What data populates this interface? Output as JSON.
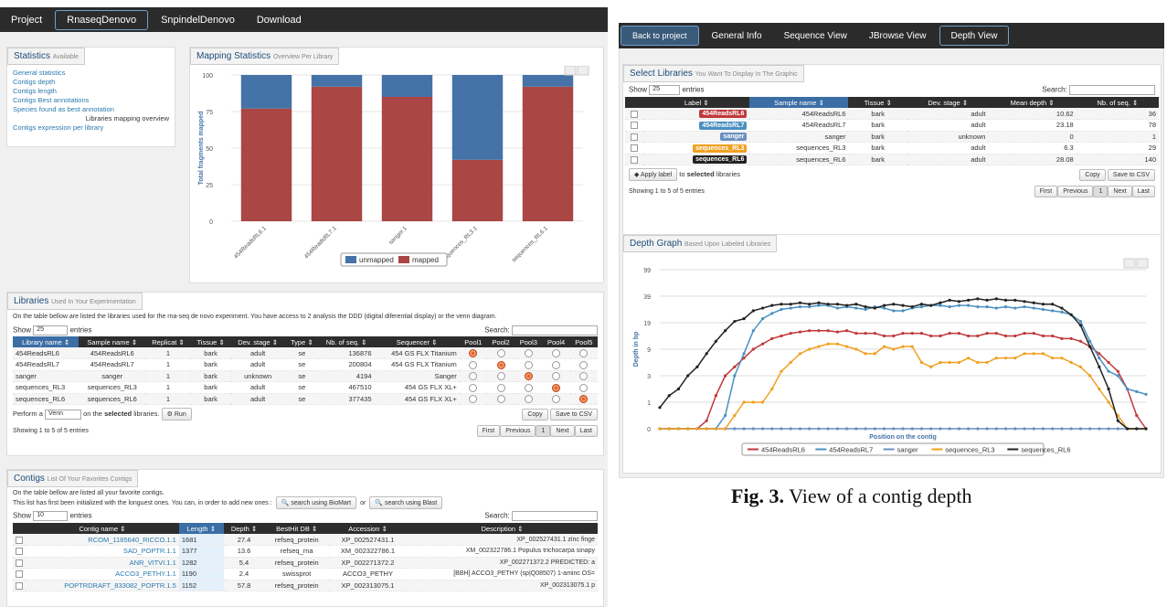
{
  "left": {
    "nav": [
      "Project",
      "RnaseqDenovo",
      "SnpindelDenovo",
      "Download"
    ],
    "stats": {
      "title": "Statistics",
      "sub": "Available",
      "links": [
        "General statistics",
        "Contigs depth",
        "Contigs length",
        "Contigs Best annotations",
        "Species found as best annotation"
      ],
      "current": "Libraries mapping overview",
      "last": "Contigs expression per library"
    },
    "mapping": {
      "title": "Mapping Statistics",
      "sub": "Overview Per Library"
    },
    "libs": {
      "title": "Libraries",
      "sub": "Used In Your Experimentation",
      "desc": "On the table bellow are listed the libraries used for the rna-seq de novo experiment. You have access to 2 analysis the DDD (digital diferential display) or the venn diagram.",
      "show": "Show",
      "n": "25",
      "entries": "entries",
      "search": "Search:",
      "headers": [
        "Library name",
        "Sample name",
        "Replicat",
        "Tissue",
        "Dev. stage",
        "Type",
        "Nb. of seq.",
        "Sequencer",
        "Pool1",
        "Pool2",
        "Pool3",
        "Pool4",
        "Pool5"
      ],
      "rows": [
        [
          "454ReadsRL6",
          "454ReadsRL6",
          "1",
          "bark",
          "adult",
          "se",
          "136876",
          "454 GS FLX Titanium"
        ],
        [
          "454ReadsRL7",
          "454ReadsRL7",
          "1",
          "bark",
          "adult",
          "se",
          "200804",
          "454 GS FLX Titanium"
        ],
        [
          "sanger",
          "sanger",
          "1",
          "bark",
          "unknown",
          "se",
          "4194",
          "Sanger"
        ],
        [
          "sequences_RL3",
          "sequences_RL3",
          "1",
          "bark",
          "adult",
          "se",
          "467510",
          "454 GS FLX XL+"
        ],
        [
          "sequences_RL6",
          "sequences_RL6",
          "1",
          "bark",
          "adult",
          "se",
          "377435",
          "454 GS FLX XL+"
        ]
      ],
      "pools": [
        0,
        1,
        2,
        3,
        4
      ],
      "perform": "Perform a",
      "venn": "Venn",
      "onsel": "on the",
      "selected": "selected",
      "libsuffix": "libraries.",
      "run": "Run",
      "copy": "Copy",
      "csv": "Save to CSV",
      "info": "Showing 1 to 5 of 5 entries",
      "first": "First",
      "prev": "Previous",
      "page": "1",
      "next": "Next",
      "last": "Last"
    },
    "contigs": {
      "title": "Contigs",
      "sub": "List Of Your Favorites Contigs",
      "desc1": "On the table bellow are listed all your favorite contigs.",
      "desc2": "This list has first been initialized with the longuest ones. You can, in order to add new ones :",
      "biomart": "search using BioMart",
      "or": "or",
      "blast": "search using Blast",
      "show": "Show",
      "n": "10",
      "entries": "entries",
      "search": "Search:",
      "headers": [
        "Contig name",
        "Length",
        "Depth",
        "BestHit DB",
        "Accession",
        "Description"
      ],
      "rows": [
        [
          "RCOM_1185640_RICCO.1.1",
          "1681",
          "27.4",
          "refseq_protein",
          "XP_002527431.1",
          "XP_002527431.1 zinc finge"
        ],
        [
          "SAD_POPTR.1.1",
          "1377",
          "13.6",
          "refseq_rna",
          "XM_002322786.1",
          "XM_002322786.1 Populus trichocarpa sinapy"
        ],
        [
          "ANR_VITVI.1.1",
          "1282",
          "5.4",
          "refseq_protein",
          "XP_002271372.2",
          "XP_002271372.2 PREDICTED: a"
        ],
        [
          "ACCO3_PETHY.1.1",
          "1190",
          "2.4",
          "swissprot",
          "ACCO3_PETHY",
          "[BBH] ACCO3_PETHY (sp|Q08507) 1-aminc OS="
        ],
        [
          "POPTRDRAFT_833082_POPTR.1.5",
          "1152",
          "57.8",
          "refseq_protein",
          "XP_002313075.1",
          "XP_002313075.1 p"
        ]
      ]
    }
  },
  "right": {
    "nav": [
      "Back to project",
      "General Info",
      "Sequence View",
      "JBrowse View",
      "Depth View"
    ],
    "select": {
      "title": "Select Libraries",
      "sub": "You Want To Display In The Graphic",
      "show": "Show",
      "n": "25",
      "entries": "entries",
      "search": "Search:",
      "headers": [
        "Label",
        "Sample name",
        "Tissue",
        "Dev. stage",
        "Mean depth",
        "Nb. of seq."
      ],
      "rows": [
        [
          "454ReadsRL6",
          "454ReadsRL6",
          "bark",
          "adult",
          "10.62",
          "36"
        ],
        [
          "454ReadsRL7",
          "454ReadsRL7",
          "bark",
          "adult",
          "23.18",
          "78"
        ],
        [
          "sanger",
          "sanger",
          "bark",
          "unknown",
          "0",
          "1"
        ],
        [
          "sequences_RL3",
          "sequences_RL3",
          "bark",
          "adult",
          "6.3",
          "29"
        ],
        [
          "sequences_RL6",
          "sequences_RL6",
          "bark",
          "adult",
          "28.08",
          "140"
        ]
      ],
      "apply": "Apply label",
      "to": "to",
      "selected": "selected",
      "libraries": "libraries",
      "copy": "Copy",
      "csv": "Save to CSV",
      "info": "Showing 1 to 5 of 5 entries",
      "first": "First",
      "prev": "Previous",
      "page": "1",
      "next": "Next",
      "last": "Last"
    },
    "depth": {
      "title": "Depth Graph",
      "sub": "Based Upon Labeled Libraries"
    },
    "caption_bold": "Fig. 3.",
    "caption_text": " View of a contig depth"
  },
  "colors": {
    "unmapped": "#4572a7",
    "mapped": "#aa4643",
    "rl6": "#c0393b",
    "rl7": "#4a90c0",
    "sanger": "#6a8fc0",
    "rl3": "#f0a020",
    "srl6": "#222222"
  },
  "chart_data": [
    {
      "type": "bar",
      "stacked": true,
      "categories": [
        "454ReadsRL6.1",
        "454ReadsRL7.1",
        "sanger.1",
        "sequences_RL3.1",
        "sequences_RL6.1"
      ],
      "series": [
        {
          "name": "unmapped",
          "values": [
            23,
            8,
            15,
            58,
            8
          ]
        },
        {
          "name": "mapped",
          "values": [
            77,
            92,
            85,
            42,
            92
          ]
        }
      ],
      "ylabel": "Total fragments mapped",
      "ylim": [
        0,
        100
      ],
      "yticks": [
        0,
        25,
        50,
        75,
        100
      ],
      "legend": "bottom"
    },
    {
      "type": "line",
      "xlabel": "Position on the contig",
      "ylabel": "Depth in bp",
      "yticks": [
        "0",
        "1",
        "3",
        "9",
        "19",
        "39",
        "99"
      ],
      "legend": "bottom",
      "series": [
        {
          "name": "454ReadsRL6",
          "values": [
            0,
            0,
            0,
            0,
            0,
            0.3,
            1.5,
            3,
            5,
            7,
            9,
            11,
            13,
            14,
            15,
            15.5,
            16,
            16,
            16,
            15.5,
            16,
            15,
            15,
            15,
            14,
            14,
            15,
            15,
            15,
            14,
            14,
            15,
            15,
            14,
            14,
            15,
            15,
            14,
            14,
            15,
            15,
            14,
            14,
            13,
            13,
            12,
            10,
            8,
            6,
            4,
            2,
            0.5,
            0
          ]
        },
        {
          "name": "454ReadsRL7",
          "values": [
            0,
            0,
            0,
            0,
            0,
            0,
            0,
            0.5,
            3,
            8,
            16,
            22,
            26,
            29,
            30,
            31,
            31,
            32,
            32,
            30,
            31,
            30,
            29,
            31,
            30,
            28,
            28,
            30,
            31,
            32,
            32,
            31,
            32,
            32,
            31,
            31,
            30,
            31,
            30,
            31,
            30,
            29,
            28,
            27,
            25,
            20,
            12,
            7,
            4,
            3,
            2,
            1.8,
            1.6
          ]
        },
        {
          "name": "sanger",
          "values": [
            0,
            0,
            0,
            0,
            0,
            0,
            0,
            0,
            0,
            0,
            0,
            0,
            0,
            0,
            0,
            0,
            0,
            0,
            0,
            0,
            0,
            0,
            0,
            0,
            0,
            0,
            0,
            0,
            0,
            0,
            0,
            0,
            0,
            0,
            0,
            0,
            0,
            0,
            0,
            0,
            0,
            0,
            0,
            0,
            0,
            0,
            0,
            0,
            0,
            0,
            0,
            0,
            0
          ]
        },
        {
          "name": "sequences_RL3",
          "values": [
            0,
            0,
            0,
            0,
            0,
            0,
            0,
            0,
            0.5,
            1,
            1,
            1,
            2,
            4,
            6,
            8,
            9,
            10,
            11,
            11,
            10,
            9,
            8,
            8,
            10,
            9,
            10,
            10,
            6,
            5,
            6,
            6,
            6,
            7,
            6,
            6,
            7,
            7,
            7,
            8,
            8,
            8,
            7,
            7,
            6,
            5,
            3,
            2,
            1,
            0.5,
            0,
            0,
            0
          ]
        },
        {
          "name": "sequences_RL6",
          "values": [
            0.8,
            1.5,
            2,
            3,
            5,
            8,
            12,
            16,
            20,
            22,
            28,
            30,
            32,
            33,
            33,
            34,
            33,
            34,
            33,
            33,
            32,
            33,
            31,
            30,
            32,
            33,
            32,
            31,
            33,
            32,
            34,
            36,
            35,
            36,
            37,
            36,
            37,
            36,
            36,
            35,
            34,
            33,
            33,
            30,
            25,
            18,
            10,
            5,
            2,
            0.3,
            0,
            0,
            0
          ]
        }
      ]
    }
  ]
}
